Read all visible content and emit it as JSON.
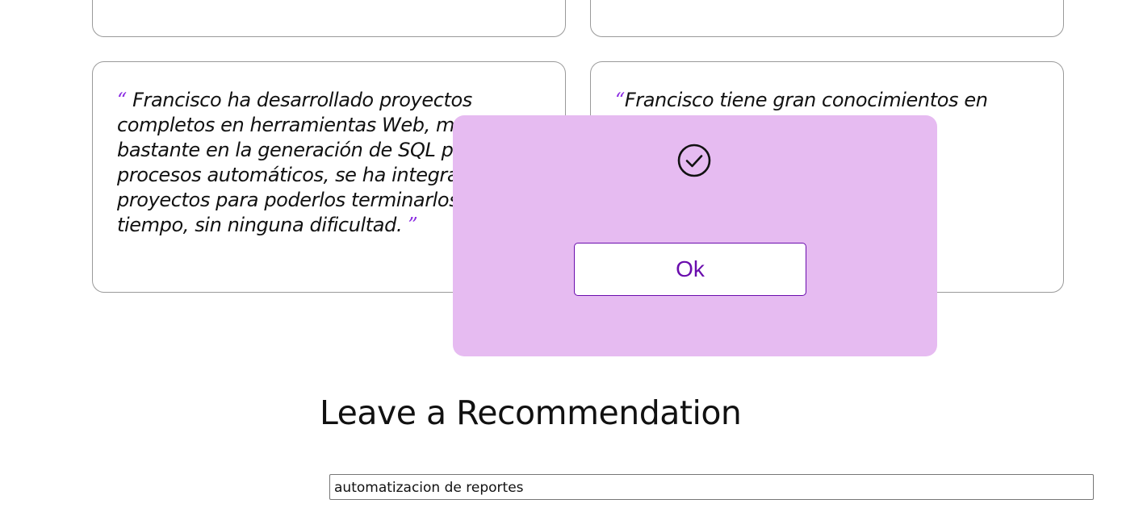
{
  "recommendations": {
    "left": {
      "open_quote": "“",
      "text": "Francisco ha desarrollado proyectos completos en herramientas Web, me ayudó bastante en la generación de SQL para procesos automáticos, se ha integrado en proyectos para poderlos terminarlos en tiempo, sin ninguna dificultad.",
      "close_quote": "”"
    },
    "right": {
      "open_quote": "“",
      "text": "Francisco tiene gran conocimientos en"
    }
  },
  "modal": {
    "icon": "check-circle-icon",
    "ok_label": "Ok",
    "background_color": "#e6bbf1",
    "accent_color": "#6a0dad"
  },
  "leave_recommendation": {
    "title": "Leave a Recommendation",
    "input_value": "automatizacion de reportes"
  }
}
